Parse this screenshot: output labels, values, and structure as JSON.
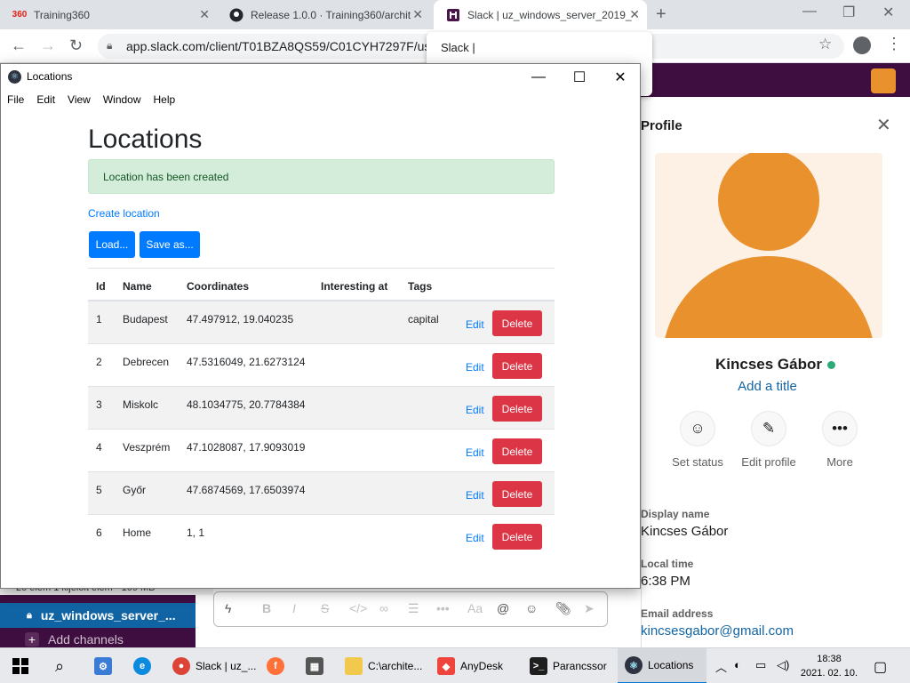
{
  "browser": {
    "tabs": [
      {
        "label": "Training360",
        "favicon": "360"
      },
      {
        "label": "Release 1.0.0 · Training360/archit",
        "favicon": "github-icon"
      },
      {
        "label": "Slack | uz_windows_server_2019_",
        "favicon": "slack-icon"
      }
    ],
    "url": "app.slack.com/client/T01BZA8QS59/C01CYH7297F/use",
    "tab_tooltip": "Slack |"
  },
  "slack": {
    "explorer_status": "20 elem     1 kijelölt elem - 109 MB",
    "channel": "uz_windows_server_...",
    "add_channels": "Add channels",
    "profile": {
      "header": "Profile",
      "name": "Kincses Gábor",
      "add_title": "Add a title",
      "actions": [
        {
          "label": "Set status",
          "icon": "☺"
        },
        {
          "label": "Edit profile",
          "icon": "✎"
        },
        {
          "label": "More",
          "icon": "•••"
        }
      ],
      "fields": [
        {
          "label": "Display name",
          "value": "Kincses Gábor"
        },
        {
          "label": "Local time",
          "value": "6:38 PM"
        },
        {
          "label": "Email address",
          "value": "kincsesgabor@gmail.com"
        }
      ]
    }
  },
  "app": {
    "window_title": "Locations",
    "menu": [
      "File",
      "Edit",
      "View",
      "Window",
      "Help"
    ],
    "heading": "Locations",
    "alert": "Location has been created",
    "create_link": "Create location",
    "load_label": "Load...",
    "save_label": "Save as...",
    "columns": [
      "Id",
      "Name",
      "Coordinates",
      "Interesting at",
      "Tags"
    ],
    "edit_label": "Edit",
    "delete_label": "Delete",
    "rows": [
      {
        "id": "1",
        "name": "Budapest",
        "coordinates": "47.497912, 19.040235",
        "interesting_at": "",
        "tags": "capital"
      },
      {
        "id": "2",
        "name": "Debrecen",
        "coordinates": "47.5316049, 21.6273124",
        "interesting_at": "",
        "tags": ""
      },
      {
        "id": "3",
        "name": "Miskolc",
        "coordinates": "48.1034775, 20.7784384",
        "interesting_at": "",
        "tags": ""
      },
      {
        "id": "4",
        "name": "Veszprém",
        "coordinates": "47.1028087, 17.9093019",
        "interesting_at": "",
        "tags": ""
      },
      {
        "id": "5",
        "name": "Győr",
        "coordinates": "47.6874569, 17.6503974",
        "interesting_at": "",
        "tags": ""
      },
      {
        "id": "6",
        "name": "Home",
        "coordinates": "1, 1",
        "interesting_at": "",
        "tags": ""
      }
    ]
  },
  "taskbar": {
    "items": [
      {
        "label": "Slack | uz_...",
        "icon": "chrome-icon"
      },
      {
        "label": "C:\\archite...",
        "icon": "folder-icon"
      },
      {
        "label": "AnyDesk",
        "icon": "anydesk-icon"
      },
      {
        "label": "Parancssor",
        "icon": "terminal-icon"
      },
      {
        "label": "Locations",
        "icon": "electron-icon"
      }
    ],
    "time": "18:38",
    "date": "2021. 02. 10."
  },
  "colors": {
    "primary": "#007bff",
    "danger": "#dc3545",
    "success_bg": "#d4edda",
    "slack_aubergine": "#3f0e40",
    "avatar_orange": "#e8912d"
  }
}
